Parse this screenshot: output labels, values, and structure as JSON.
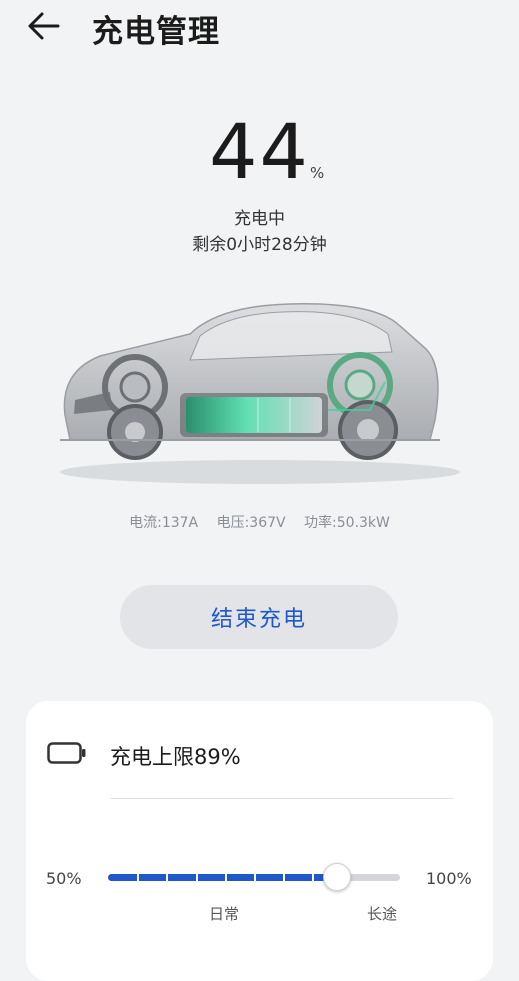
{
  "header": {
    "title": "充电管理"
  },
  "charge": {
    "percent": "44",
    "unit": "%",
    "status": "充电中",
    "remaining": "剩余0小时28分钟"
  },
  "metrics": {
    "current": "电流:137A",
    "voltage": "电压:367V",
    "power": "功率:50.3kW"
  },
  "actions": {
    "end_label": "结束充电"
  },
  "limit": {
    "label": "充电上限89%",
    "min": "50%",
    "max": "100%",
    "mark_daily": "日常",
    "mark_long": "长途",
    "value_percent": 89
  },
  "colors": {
    "accent": "#1f58c9",
    "background": "#f1f3f5",
    "charge_glow": "#3fd39a"
  },
  "icons": {
    "back": "arrow-left-icon",
    "battery": "battery-outline-icon"
  }
}
